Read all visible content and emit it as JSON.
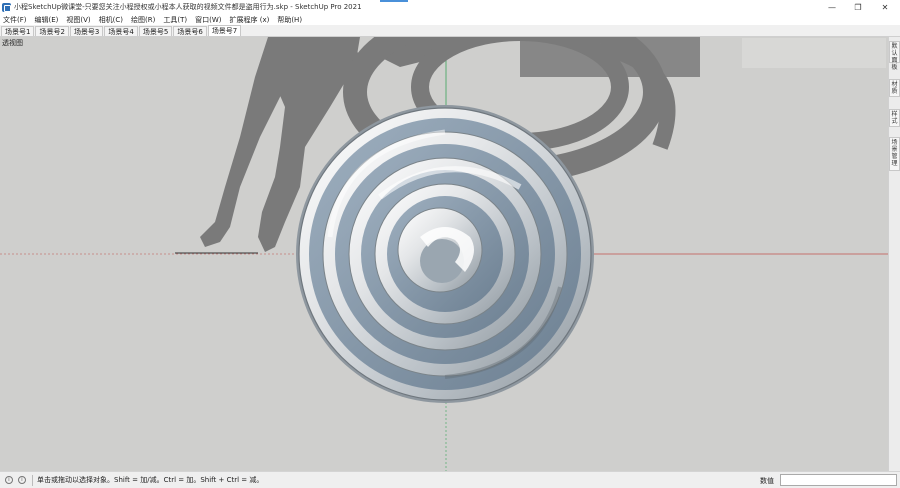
{
  "window": {
    "title": "小程SketchUp微课堂-只要您关注小程授权或小程本人获取的视频文件都是盗用行为.skp - SketchUp Pro 2021",
    "minimize_glyph": "—",
    "restore_glyph": "❐",
    "close_glyph": "✕"
  },
  "menu": {
    "items": [
      "文件(F)",
      "编辑(E)",
      "视图(V)",
      "相机(C)",
      "绘图(R)",
      "工具(T)",
      "窗口(W)",
      "扩展程序 (x)",
      "帮助(H)"
    ]
  },
  "scenes": {
    "tabs": [
      "场景号1",
      "场景号2",
      "场景号3",
      "场景号4",
      "场景号5",
      "场景号6",
      "场景号7"
    ],
    "active_index": 6
  },
  "viewport": {
    "label": "透视图",
    "colors": {
      "background": "#cfcfcd",
      "shadow": "#7a7a7a",
      "red_axis": "#c0504d",
      "green_axis": "#3aa35a"
    }
  },
  "tray": {
    "tabs": [
      "默认面板",
      "材质",
      "样式",
      "场景管理"
    ]
  },
  "status": {
    "geo_icon": "i",
    "info_icon": "i",
    "message": "单击或拖动以选择对象。Shift = 加/减。Ctrl = 加。Shift + Ctrl = 减。",
    "measure_label": "数值",
    "measure_value": ""
  }
}
